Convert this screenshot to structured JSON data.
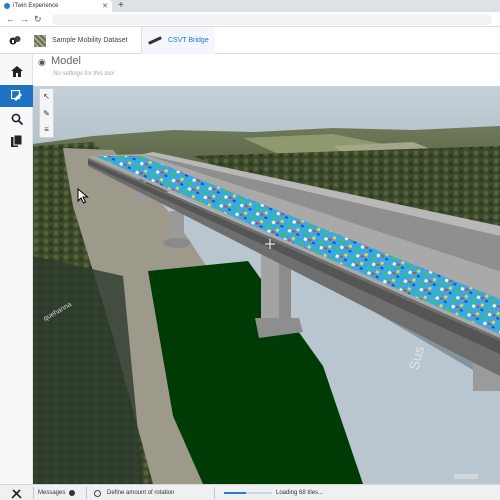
{
  "browser": {
    "tab_title": "iTwin Experience",
    "tab_close": "✕",
    "new_tab": "+",
    "back": "←",
    "forward": "→",
    "reload": "↻"
  },
  "header": {
    "breadcrumb_dataset": "Sample Mobility Dataset",
    "breadcrumb_bridge": "CSVT Bridge"
  },
  "panel": {
    "title": "Model",
    "subtitle": "No settings for this tool"
  },
  "tools": {
    "select": "↖",
    "measure": "✎",
    "menu": "≡"
  },
  "status": {
    "messages_label": "Messages",
    "rotation_hint": "Define amount of rotation",
    "loading_text": "Loading 68 tiles...",
    "progress_fraction": 0.45
  },
  "colors": {
    "accent": "#1f73c4",
    "link": "#1a79d0"
  }
}
